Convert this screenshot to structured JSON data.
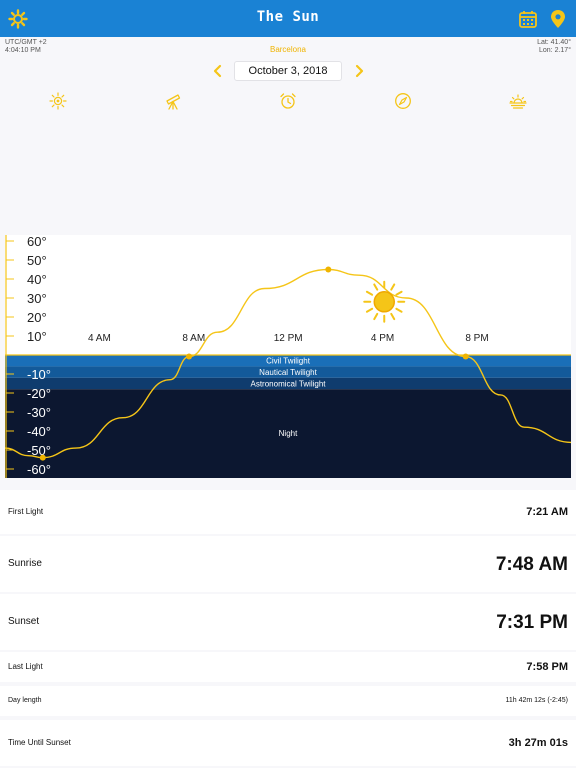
{
  "header": {
    "title": "The Sun",
    "settings_icon": "gear-icon",
    "calendar_icon": "calendar-icon",
    "location_icon": "location-pin-icon",
    "accent": "#1a82d4"
  },
  "info": {
    "timezone": "UTC/GMT +2",
    "time": "4:04:10 PM",
    "lat": "Lat: 41.40°",
    "lon": "Lon: 2.17°",
    "city": "Barcelona"
  },
  "date": {
    "value": "October 3, 2018",
    "prev_icon": "chevron-left-icon",
    "next_icon": "chevron-right-icon"
  },
  "toolbar": {
    "items": [
      "sun-icon",
      "telescope-icon",
      "alarm-icon",
      "compass-icon",
      "sunrise-icon"
    ]
  },
  "chart_data": {
    "type": "line",
    "x_ticks": [
      "4 AM",
      "8 AM",
      "12 PM",
      "4 PM",
      "8 PM"
    ],
    "y_ticks_positive": [
      "60°",
      "50°",
      "40°",
      "30°",
      "20°",
      "10°"
    ],
    "y_ticks_negative": [
      "-10°",
      "-20°",
      "-30°",
      "-40°",
      "-50°",
      "-60°"
    ],
    "bands": [
      "Civil Twilight",
      "Nautical Twilight",
      "Astronomical Twilight",
      "Night"
    ],
    "band_colors": [
      "#1a6fb8",
      "#135a9a",
      "#0f3c6e",
      "#0c1730"
    ],
    "xlim": [
      0,
      24
    ],
    "ylim": [
      -70,
      62
    ],
    "curve_color": "#f5c518",
    "series": [
      {
        "x": [
          0,
          1,
          1.6,
          3,
          5,
          7,
          7.8,
          9,
          11,
          13.7,
          15,
          17,
          19.52,
          21,
          22,
          24
        ],
        "y": [
          -49,
          -53,
          -54,
          -49,
          -33,
          -13,
          -0.8,
          12,
          35,
          45,
          42,
          30,
          -0.8,
          -21,
          -38,
          -46
        ]
      }
    ],
    "markers": [
      {
        "x": 1.6,
        "y": -54
      },
      {
        "x": 7.8,
        "y": -0.8
      },
      {
        "x": 13.7,
        "y": 45
      },
      {
        "x": 19.52,
        "y": -0.8
      }
    ],
    "current_sun": {
      "x": 16.07,
      "y": 28
    },
    "grid": false
  },
  "details": [
    {
      "label": "First Light",
      "value": "7:21 AM",
      "size": "small"
    },
    {
      "label": "Sunrise",
      "value": "7:48 AM",
      "size": "large"
    },
    {
      "label": "Sunset",
      "value": "7:31 PM",
      "size": "large"
    },
    {
      "label": "Last Light",
      "value": "7:58 PM",
      "size": "small"
    },
    {
      "label": "Day length",
      "value": "11h 42m 12s (-2:45)",
      "size": "tiny"
    },
    {
      "label": "Time Until Sunset",
      "value": "3h 27m 01s",
      "size": "small"
    }
  ]
}
